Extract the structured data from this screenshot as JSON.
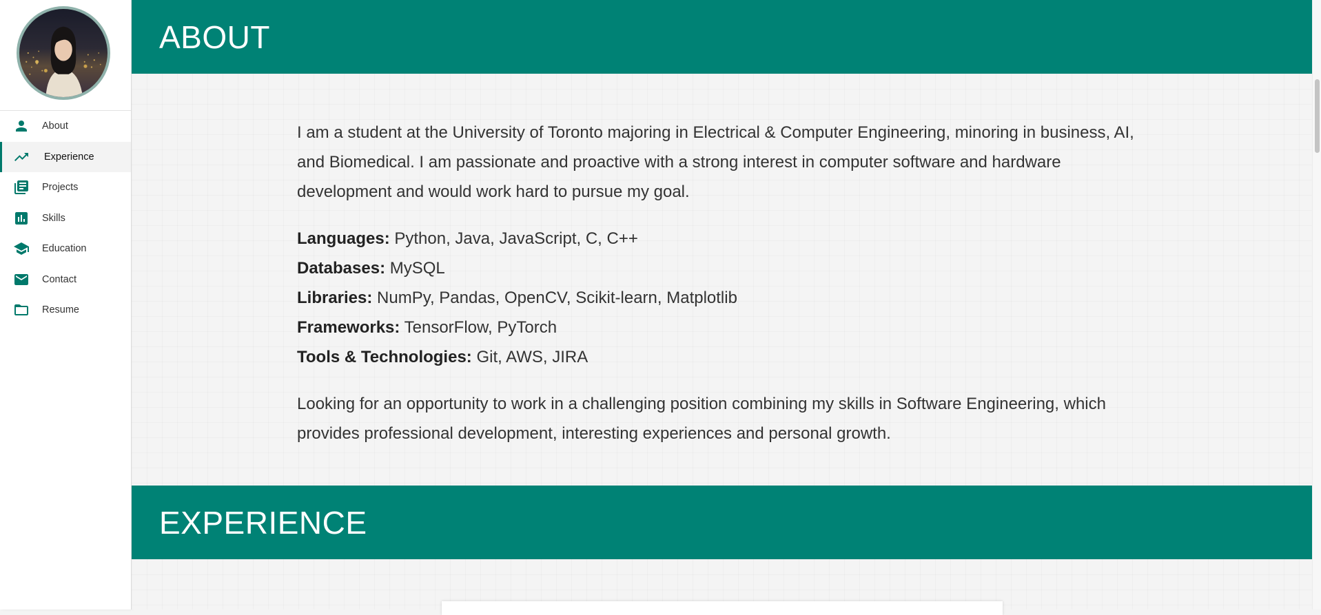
{
  "sidebar": {
    "items": [
      {
        "label": "About",
        "icon": "person-icon"
      },
      {
        "label": "Experience",
        "icon": "trending-up-icon",
        "active": true
      },
      {
        "label": "Projects",
        "icon": "library-books-icon"
      },
      {
        "label": "Skills",
        "icon": "bar-chart-icon"
      },
      {
        "label": "Education",
        "icon": "school-icon"
      },
      {
        "label": "Contact",
        "icon": "mail-icon"
      },
      {
        "label": "Resume",
        "icon": "folder-icon"
      }
    ]
  },
  "about": {
    "title": "ABOUT",
    "intro": "I am a student at the University of Toronto majoring in Electrical & Computer Engineering, minoring in business, AI, and Biomedical. I am passionate and proactive with a strong interest in computer software and hardware development and would work hard to pursue my goal.",
    "skills": [
      {
        "label": "Languages:",
        "value": " Python, Java, JavaScript, C, C++"
      },
      {
        "label": "Databases:",
        "value": " MySQL"
      },
      {
        "label": "Libraries:",
        "value": " NumPy, Pandas, OpenCV, Scikit-learn, Matplotlib"
      },
      {
        "label": "Frameworks:",
        "value": " TensorFlow, PyTorch"
      },
      {
        "label": "Tools & Technologies:",
        "value": " Git, AWS, JIRA"
      }
    ],
    "closing": "Looking for an opportunity to work in a challenging position combining my skills in Software Engineering, which provides professional development, interesting experiences and personal growth."
  },
  "experience": {
    "title": "EXPERIENCE"
  },
  "colors": {
    "accent": "#008275",
    "icon": "#00796b"
  }
}
